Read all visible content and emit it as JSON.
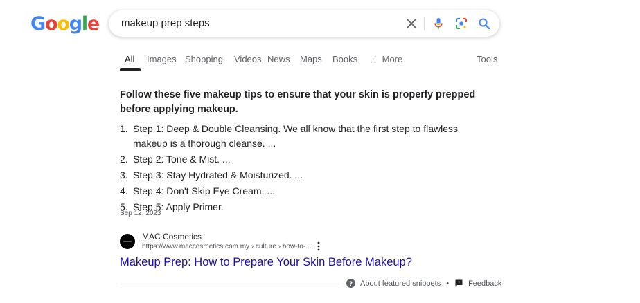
{
  "logo": {
    "letters": [
      "G",
      "o",
      "o",
      "g",
      "l",
      "e"
    ],
    "colors": [
      "#4285F4",
      "#EA4335",
      "#FBBC05",
      "#4285F4",
      "#34A853",
      "#EA4335"
    ]
  },
  "search": {
    "query": "makeup prep steps",
    "icons": [
      "clear-icon",
      "microphone-icon",
      "lens-icon",
      "search-icon"
    ]
  },
  "tabs": {
    "items": [
      {
        "label": "All",
        "active": true
      },
      {
        "label": "Images"
      },
      {
        "label": "Shopping"
      },
      {
        "label": "Videos"
      },
      {
        "label": "News"
      },
      {
        "label": "Maps"
      },
      {
        "label": "Books"
      },
      {
        "label": "More"
      }
    ],
    "tools_label": "Tools"
  },
  "snippet": {
    "heading": "Follow these five makeup tips to ensure that your skin is properly prepped before applying makeup.",
    "steps": [
      "Step 1: Deep & Double Cleansing. We all know that the first step to flawless makeup is a thorough cleanse. ...",
      "Step 2: Tone & Mist. ...",
      "Step 3: Stay Hydrated & Moisturized. ...",
      "Step 4: Don't Skip Eye Cream. ...",
      "Step 5: Apply Primer."
    ],
    "step_numbers": [
      "1.",
      "2.",
      "3.",
      "4.",
      "5."
    ],
    "date": "Sep 12, 2023"
  },
  "result": {
    "site_name": "MAC Cosmetics",
    "url": "https://www.maccosmetics.com.my › culture › how-to-...",
    "title": "Makeup Prep: How to Prepare Your Skin Before Makeup?"
  },
  "footer": {
    "about_label": "About featured snippets",
    "separator": "•",
    "feedback_label": "Feedback"
  },
  "colors": {
    "link": "#1a0dab",
    "text": "#202124",
    "secondary": "#5f6368"
  }
}
